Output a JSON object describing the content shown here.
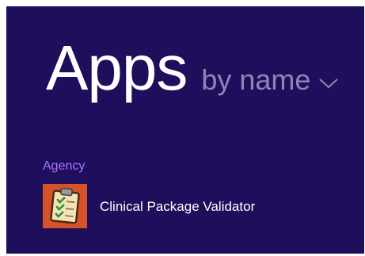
{
  "screen": {
    "title": "Apps",
    "sort_label": "by name",
    "background_color": "#1e0e5c",
    "group_color": "#a673ff"
  },
  "groups": [
    {
      "label": "Agency",
      "apps": [
        {
          "name": "Clinical Package Validator",
          "icon": "clipboard-checklist-icon",
          "tile_color": "#d6532a"
        }
      ]
    }
  ]
}
